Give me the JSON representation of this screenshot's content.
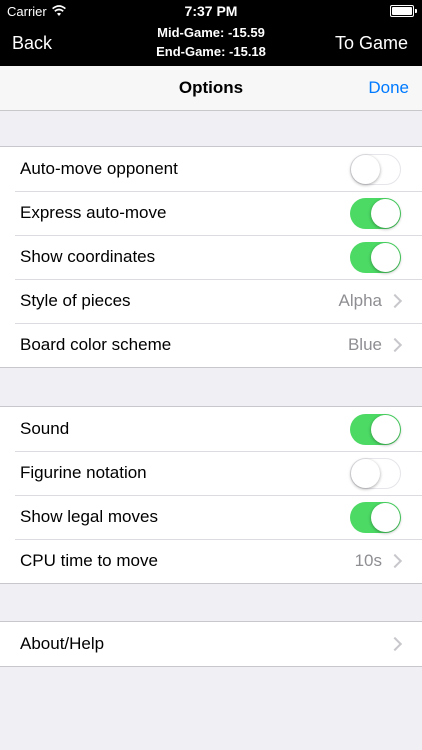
{
  "status_bar": {
    "carrier": "Carrier",
    "time": "7:37 PM",
    "wifi_icon": "wifi-icon",
    "battery_icon": "battery-icon"
  },
  "top_bar": {
    "back_label": "Back",
    "to_game_label": "To Game",
    "mid_game": "Mid-Game: -15.59",
    "end_game": "End-Game: -15.18"
  },
  "nav": {
    "title": "Options",
    "done_label": "Done"
  },
  "group1": {
    "auto_move": {
      "label": "Auto-move opponent",
      "on": false
    },
    "express": {
      "label": "Express auto-move",
      "on": true
    },
    "coords": {
      "label": "Show coordinates",
      "on": true
    },
    "pieces": {
      "label": "Style of pieces",
      "value": "Alpha"
    },
    "board": {
      "label": "Board color scheme",
      "value": "Blue"
    }
  },
  "group2": {
    "sound": {
      "label": "Sound",
      "on": true
    },
    "figurine": {
      "label": "Figurine notation",
      "on": false
    },
    "legal": {
      "label": "Show legal moves",
      "on": true
    },
    "cpu": {
      "label": "CPU time to move",
      "value": "10s"
    }
  },
  "group3": {
    "about": {
      "label": "About/Help"
    }
  },
  "colors": {
    "switch_on": "#4cd964",
    "link_blue": "#007aff",
    "background": "#efeff4"
  }
}
